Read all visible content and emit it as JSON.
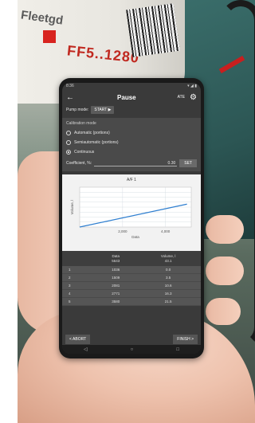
{
  "photo": {
    "filter_brand": "Fleetgd",
    "filter_code": "FF5..1280"
  },
  "status_bar": {
    "time": "8:36",
    "icons": "▾ ◢ ▮"
  },
  "app": {
    "title": "Pause",
    "ate_label": "ATE",
    "pump_mode_label": "Pump mode:",
    "start_label": "START"
  },
  "calibration": {
    "label": "Calibration mode",
    "options": [
      {
        "label": "Automatic (portions)",
        "selected": false
      },
      {
        "label": "Semiautomatic (portions)",
        "selected": false
      },
      {
        "label": "Continuous",
        "selected": true
      }
    ],
    "coefficient_label": "Coefficient, %:",
    "coefficient_value": "0.30",
    "set_label": "SET"
  },
  "chart_data": {
    "type": "line",
    "title": "A/F 1",
    "xlabel": "Data",
    "ylabel": "Volume, l",
    "x": [
      0,
      5000
    ],
    "y": [
      0,
      23
    ],
    "xticks": [
      "2,000",
      "4,000"
    ],
    "xlim": [
      0,
      5200
    ],
    "ylim": [
      0,
      40
    ],
    "grid": true,
    "series_color": "#2f7fd0"
  },
  "table": {
    "headers": [
      {
        "label": "",
        "sub": ""
      },
      {
        "label": "Data",
        "sub": "5643"
      },
      {
        "label": "Volume, l",
        "sub": "43.1"
      }
    ],
    "rows": [
      [
        "1",
        "1036",
        "0.0"
      ],
      [
        "2",
        "1509",
        "3.5"
      ],
      [
        "3",
        "2081",
        "10.6"
      ],
      [
        "4",
        "2771",
        "16.3"
      ],
      [
        "5",
        "3580",
        "21.5"
      ]
    ]
  },
  "buttons": {
    "abort": "< ABORT",
    "finish": "FINISH >"
  },
  "navbar": {
    "back": "◁",
    "home": "○",
    "recent": "□"
  }
}
